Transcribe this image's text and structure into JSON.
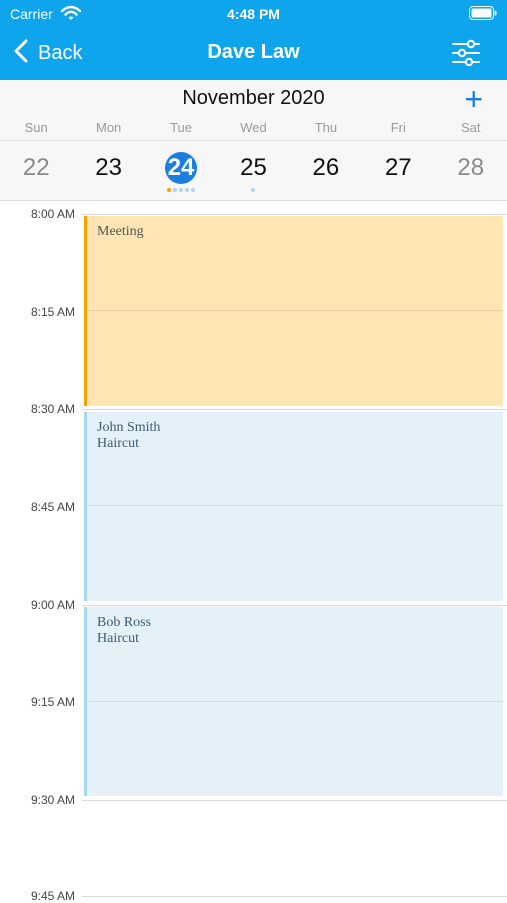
{
  "status": {
    "carrier": "Carrier",
    "time": "4:48 PM"
  },
  "nav": {
    "back_label": "Back",
    "title": "Dave Law"
  },
  "calendar": {
    "month": "November 2020",
    "add_symbol": "+",
    "weekdays": [
      "Sun",
      "Mon",
      "Tue",
      "Wed",
      "Thu",
      "Fri",
      "Sat"
    ],
    "dates": [
      "22",
      "23",
      "24",
      "25",
      "26",
      "27",
      "28"
    ],
    "selected_date": "24"
  },
  "timeline": {
    "times": [
      "8:00 AM",
      "8:15 AM",
      "8:30 AM",
      "8:45 AM",
      "9:00 AM",
      "9:15 AM",
      "9:30 AM",
      "9:45 AM"
    ]
  },
  "events": [
    {
      "title": "Meeting",
      "subtitle": "",
      "start": "8:00 AM",
      "end": "8:30 AM"
    },
    {
      "title": "John Smith",
      "subtitle": "Haircut",
      "start": "8:30 AM",
      "end": "9:00 AM"
    },
    {
      "title": "Bob Ross",
      "subtitle": "Haircut",
      "start": "9:00 AM",
      "end": "9:30 AM"
    }
  ],
  "colors": {
    "header_bg": "#0ea5ec",
    "accent": "#1a7fe0",
    "meeting_bg": "#ffe4b4",
    "meeting_bar": "#f5a300",
    "haircut_bg": "#e4f1f8",
    "haircut_bar": "#a9d6e8",
    "dot_orange": "#f5a300",
    "dot_blue": "#a9d6e8"
  }
}
